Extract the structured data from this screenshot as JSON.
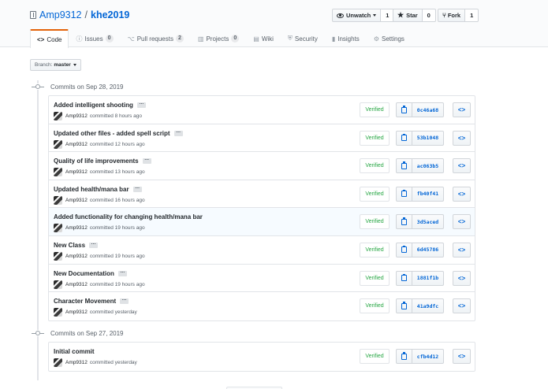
{
  "repo": {
    "owner": "Amp9312",
    "separator": "/",
    "name": "khe2019"
  },
  "actions": {
    "watch": {
      "label": "Unwatch",
      "count": "1"
    },
    "star": {
      "label": "Star",
      "count": "0"
    },
    "fork": {
      "label": "Fork",
      "count": "1"
    }
  },
  "nav": [
    {
      "label": "Code",
      "icon": "code-icon",
      "glyph": "<>",
      "counter": ""
    },
    {
      "label": "Issues",
      "icon": "issue-icon",
      "glyph": "ⓘ",
      "counter": "0"
    },
    {
      "label": "Pull requests",
      "icon": "pull-request-icon",
      "glyph": "⌥",
      "counter": "2"
    },
    {
      "label": "Projects",
      "icon": "project-icon",
      "glyph": "▥",
      "counter": "0"
    },
    {
      "label": "Wiki",
      "icon": "wiki-icon",
      "glyph": "▤",
      "counter": ""
    },
    {
      "label": "Security",
      "icon": "shield-icon",
      "glyph": "⛨",
      "counter": ""
    },
    {
      "label": "Insights",
      "icon": "graph-icon",
      "glyph": "▮",
      "counter": ""
    },
    {
      "label": "Settings",
      "icon": "gear-icon",
      "glyph": "⚙",
      "counter": ""
    }
  ],
  "branch": {
    "label": "Branch:",
    "value": "master"
  },
  "groups": [
    {
      "title": "Commits on Sep 28, 2019",
      "commits": [
        {
          "message": "Added intelligent shooting",
          "author": "Amp9312",
          "time": "committed 8 hours ago",
          "verified": "Verified",
          "sha": "0c46a68",
          "has_ellipsis": true
        },
        {
          "message": "Updated other files - added spell script",
          "author": "Amp9312",
          "time": "committed 12 hours ago",
          "verified": "Verified",
          "sha": "53b1048",
          "has_ellipsis": true
        },
        {
          "message": "Quality of life improvements",
          "author": "Amp9312",
          "time": "committed 13 hours ago",
          "verified": "Verified",
          "sha": "ac063b5",
          "has_ellipsis": true
        },
        {
          "message": "Updated health/mana bar",
          "author": "Amp9312",
          "time": "committed 16 hours ago",
          "verified": "Verified",
          "sha": "fb40f41",
          "has_ellipsis": true
        },
        {
          "message": "Added functionality for changing health/mana bar",
          "author": "Amp9312",
          "time": "committed 19 hours ago",
          "verified": "Verified",
          "sha": "3d5aced",
          "has_ellipsis": false
        },
        {
          "message": "New Class",
          "author": "Amp9312",
          "time": "committed 19 hours ago",
          "verified": "Verified",
          "sha": "6d45786",
          "has_ellipsis": true
        },
        {
          "message": "New Documentation",
          "author": "Amp9312",
          "time": "committed 19 hours ago",
          "verified": "Verified",
          "sha": "1881f1b",
          "has_ellipsis": true
        },
        {
          "message": "Character Movement",
          "author": "Amp9312",
          "time": "committed yesterday",
          "verified": "Verified",
          "sha": "41a9dfc",
          "has_ellipsis": true
        }
      ]
    },
    {
      "title": "Commits on Sep 27, 2019",
      "commits": [
        {
          "message": "Initial commit",
          "author": "Amp9312",
          "time": "committed yesterday",
          "verified": "Verified",
          "sha": "cfb4d12",
          "has_ellipsis": false
        }
      ]
    }
  ],
  "icons": {
    "browse": "<>",
    "ellipsis": "…"
  },
  "colors": {
    "link": "#0366d6",
    "verified": "#28a745",
    "tab_accent": "#e36209"
  }
}
